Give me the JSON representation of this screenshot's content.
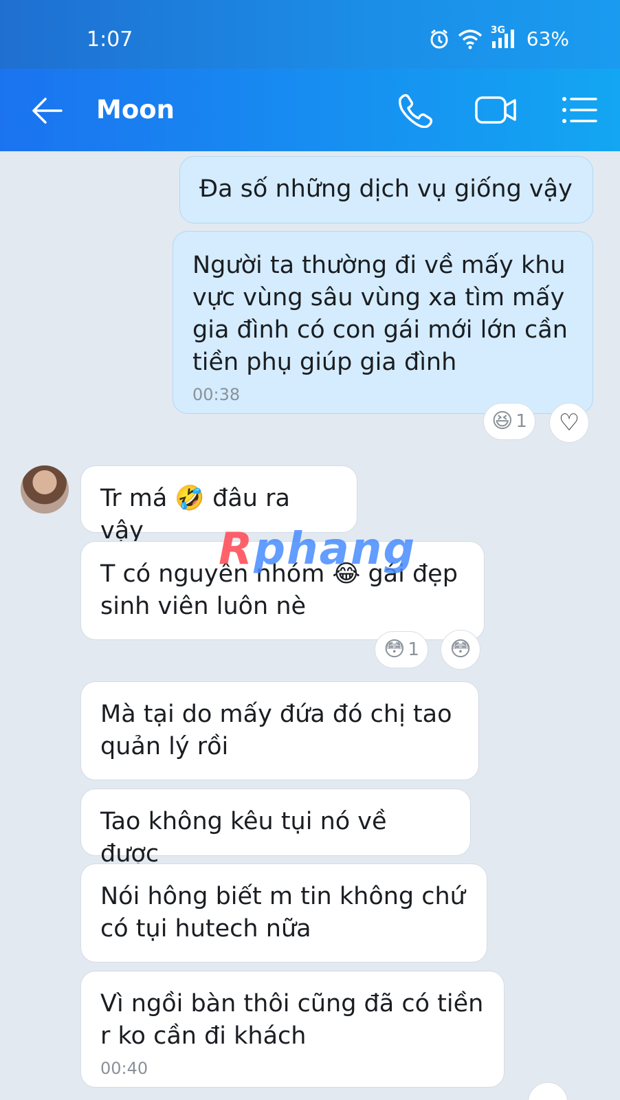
{
  "status": {
    "time": "1:07",
    "network": "3G",
    "battery": "63%",
    "icons": [
      "alarm-icon",
      "wifi-icon",
      "signal-icon"
    ]
  },
  "header": {
    "title": "Moon",
    "icons": [
      "back-arrow-icon",
      "phone-icon",
      "video-camera-icon",
      "menu-list-icon"
    ]
  },
  "messages": [
    {
      "from": "me",
      "text": "Đa số những dịch vụ giống vậy"
    },
    {
      "from": "me",
      "lines": [
        "Người ta thường đi về mấy khu",
        "vực vùng sâu vùng xa tìm mấy",
        "gia đình có con gái mới lớn cần",
        "tiền phụ giúp gia đình"
      ],
      "time": "00:38",
      "reaction": {
        "emoji": "😆",
        "count": "1"
      },
      "heart": "♡"
    },
    {
      "from": "them",
      "text": "Tr má 🤣 đâu ra vậy"
    },
    {
      "from": "them",
      "lines": [
        "T có nguyên nhóm 😂 gái đẹp",
        "sinh viên luôn nè"
      ],
      "reaction": {
        "emoji": "😳",
        "count": "1"
      },
      "quick_reaction": "😳"
    },
    {
      "from": "them",
      "lines": [
        "Mà tại do mấy đứa đó chị tao",
        "quản lý rồi"
      ]
    },
    {
      "from": "them",
      "text": "Tao không kêu tụi nó về được"
    },
    {
      "from": "them",
      "lines": [
        "Nói hông biết m tin không chứ",
        "có tụi hutech nữa"
      ]
    },
    {
      "from": "them",
      "lines": [
        "Vì ngồi bàn thôi cũng đã có tiền",
        "r ko cần đi khách"
      ],
      "time": "00:40"
    }
  ],
  "watermark": {
    "first": "R",
    "rest": "phang"
  },
  "colors": {
    "accent": "#1b73f0",
    "my_bubble": "#d4ecfd",
    "their_bubble": "#ffffff",
    "background": "#e2e9f1"
  }
}
